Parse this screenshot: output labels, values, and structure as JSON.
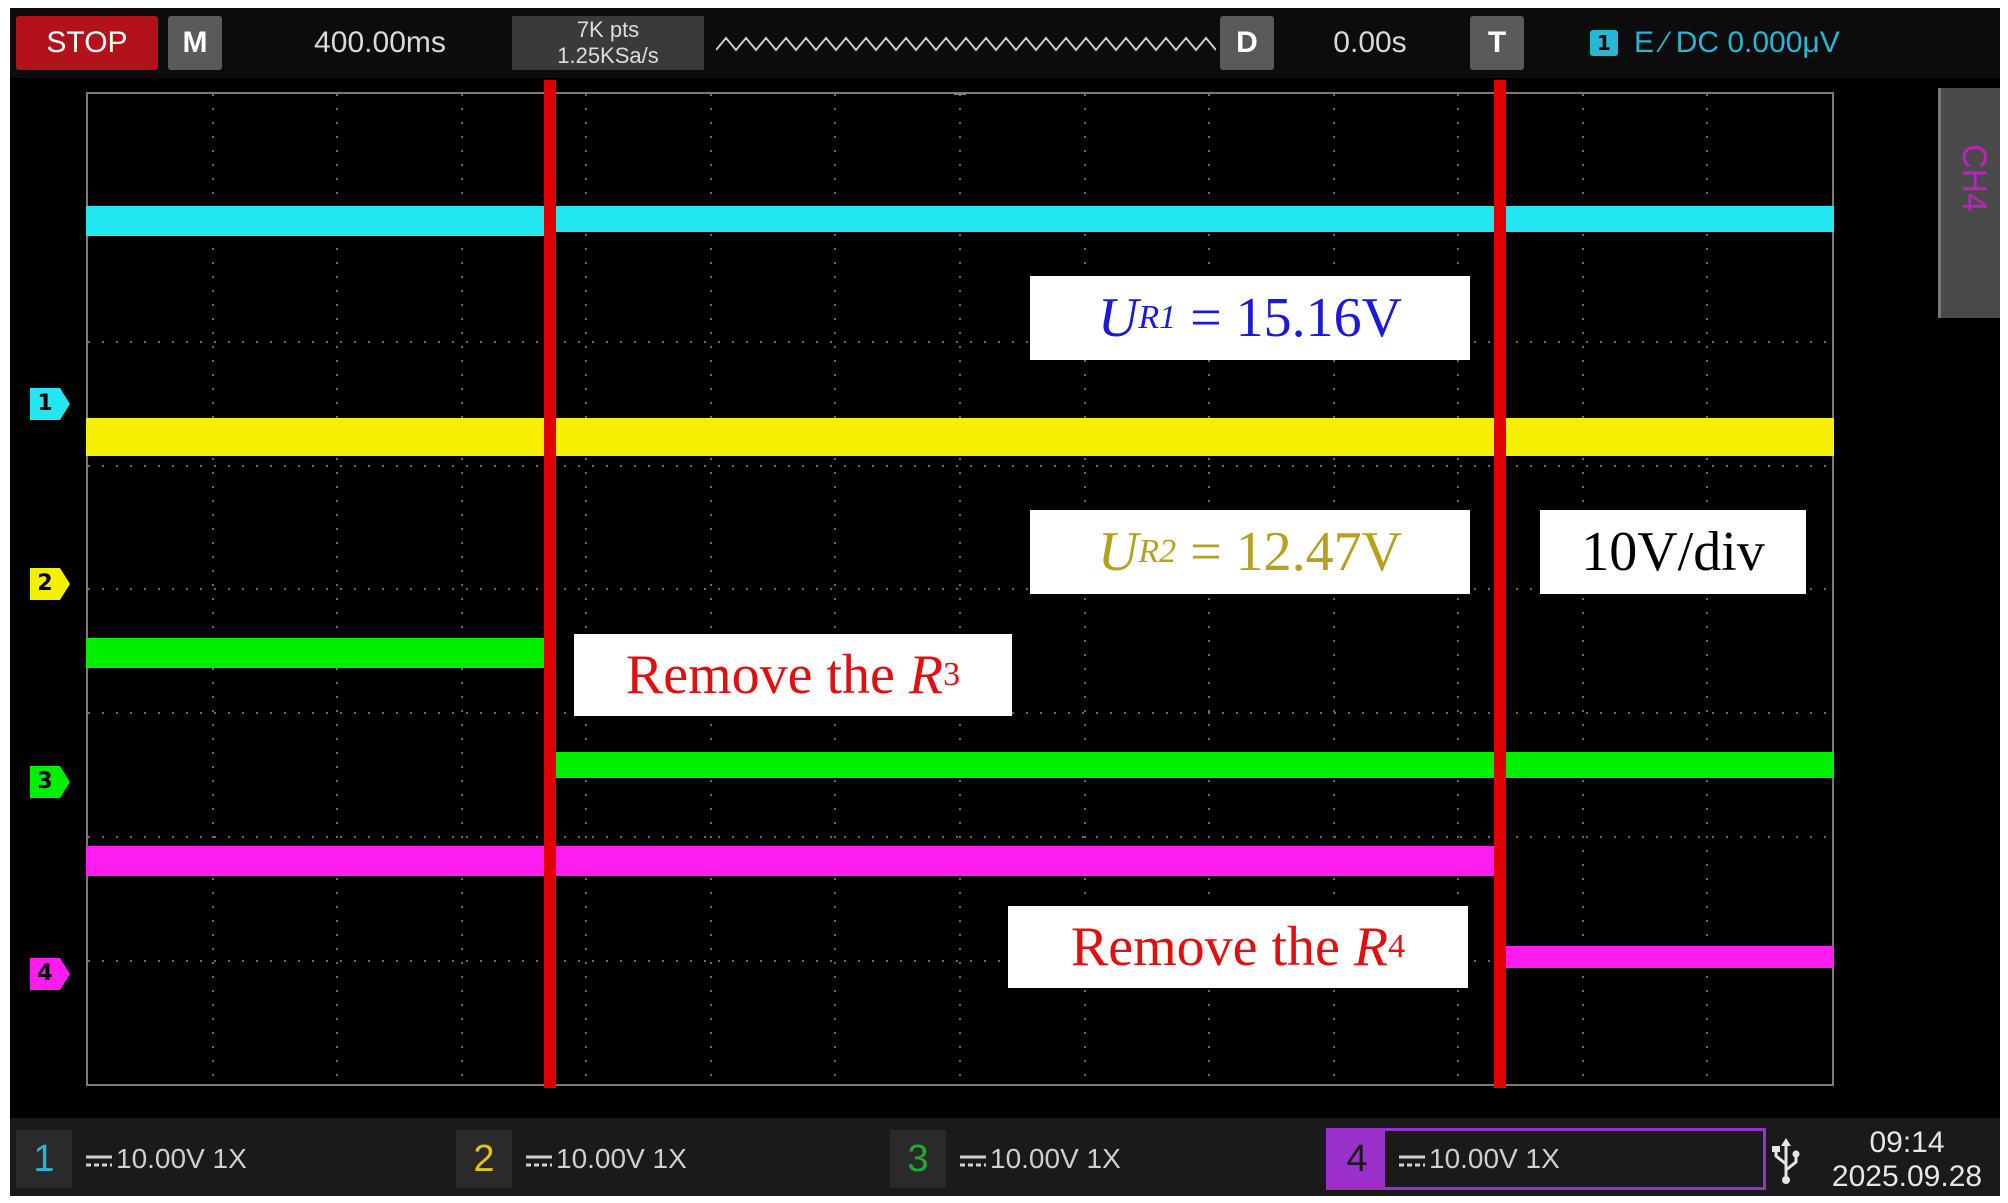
{
  "topbar": {
    "stop_label": "STOP",
    "m_label": "M",
    "timebase": "400.00ms",
    "points": "7K pts",
    "sample_rate": "1.25KSa/s",
    "d_label": "D",
    "delay": "0.00s",
    "t_label": "T",
    "trigger_channel": "1",
    "trigger_info": "E ⁄ DC 0.000μV"
  },
  "side_tab": {
    "label": "CH4"
  },
  "channel_markers": [
    "1",
    "2",
    "3",
    "4"
  ],
  "annotations": {
    "ur1": {
      "symbol": "U",
      "sub": "R1",
      "value": "= 15.16V"
    },
    "ur2": {
      "symbol": "U",
      "sub": "R2",
      "value": "= 12.47V"
    },
    "scale": "10V/div",
    "remove_r3": {
      "text": "Remove the ",
      "symbol": "R",
      "sub": "3"
    },
    "remove_r4": {
      "text": "Remove the ",
      "symbol": "R",
      "sub": "4"
    }
  },
  "channels": [
    {
      "number": "1",
      "info": "10.00V 1X",
      "color": "#27b7d6"
    },
    {
      "number": "2",
      "info": "10.00V 1X",
      "color": "#e6c21a"
    },
    {
      "number": "3",
      "info": "10.00V 1X",
      "color": "#1fae2c"
    },
    {
      "number": "4",
      "info": "10.00V 1X",
      "color": "#9b2fc9"
    }
  ],
  "trace_colors": {
    "ch1": "#22e6f0",
    "ch2": "#f5f000",
    "ch3": "#00f000",
    "ch4": "#ff1cf0"
  },
  "clock": {
    "time": "09:14",
    "date": "2025.09.28"
  },
  "icons": {
    "usb": "usb-icon"
  }
}
